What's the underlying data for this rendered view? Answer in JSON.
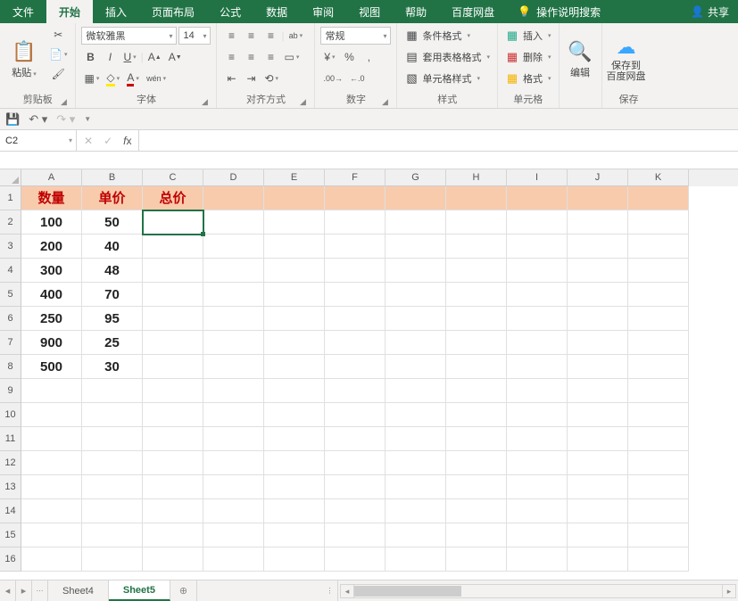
{
  "tabs": {
    "file": "文件",
    "home": "开始",
    "insert": "插入",
    "layout": "页面布局",
    "formula": "公式",
    "data": "数据",
    "review": "审阅",
    "view": "视图",
    "help": "帮助",
    "baidu": "百度网盘",
    "tellme": "操作说明搜索",
    "share": "共享"
  },
  "ribbon": {
    "clipboard": {
      "paste": "粘贴",
      "label": "剪贴板"
    },
    "font": {
      "name": "微软雅黑",
      "size": "14",
      "label": "字体"
    },
    "align": {
      "label": "对齐方式"
    },
    "number": {
      "fmt": "常规",
      "label": "数字"
    },
    "styles": {
      "cond": "条件格式",
      "table": "套用表格格式",
      "cell": "单元格样式",
      "label": "样式"
    },
    "cells": {
      "insert": "插入",
      "delete": "删除",
      "format": "格式",
      "label": "单元格"
    },
    "editing": {
      "label": "编辑"
    },
    "save": {
      "btn": "保存到\n百度网盘",
      "label": "保存"
    }
  },
  "qat": {
    "save": "💾"
  },
  "fx": {
    "name": "C2"
  },
  "columns": [
    "A",
    "B",
    "C",
    "D",
    "E",
    "F",
    "G",
    "H",
    "I",
    "J",
    "K"
  ],
  "rowcount": 16,
  "headers": {
    "A": "数量",
    "B": "单价",
    "C": "总价"
  },
  "data": [
    {
      "A": "100",
      "B": "50"
    },
    {
      "A": "200",
      "B": "40"
    },
    {
      "A": "300",
      "B": "48"
    },
    {
      "A": "400",
      "B": "70"
    },
    {
      "A": "250",
      "B": "95"
    },
    {
      "A": "900",
      "B": "25"
    },
    {
      "A": "500",
      "B": "30"
    }
  ],
  "selected": {
    "row": 2,
    "col": "C"
  },
  "sheets": {
    "s1": "Sheet4",
    "s2": "Sheet5"
  }
}
